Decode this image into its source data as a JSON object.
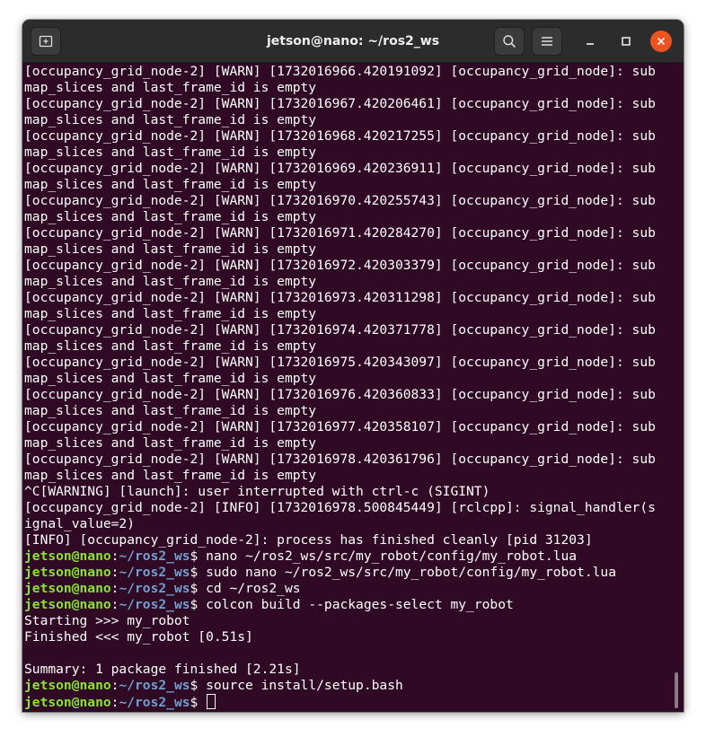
{
  "window": {
    "title": "jetson@nano: ~/ros2_ws",
    "accent": "#e95420",
    "background": "#300a24"
  },
  "toolbar": {
    "new_tab_icon": "new-tab-icon",
    "search_icon": "search-icon",
    "menu_icon": "hamburger-menu-icon",
    "minimize_icon": "minimize-icon",
    "maximize_icon": "maximize-icon",
    "close_icon": "close-icon"
  },
  "terminal": {
    "output_lines": [
      "[occupancy_grid_node-2] [WARN] [1732016966.420191092] [occupancy_grid_node]: sub",
      "map_slices and last_frame_id is empty",
      "[occupancy_grid_node-2] [WARN] [1732016967.420206461] [occupancy_grid_node]: sub",
      "map_slices and last_frame_id is empty",
      "[occupancy_grid_node-2] [WARN] [1732016968.420217255] [occupancy_grid_node]: sub",
      "map_slices and last_frame_id is empty",
      "[occupancy_grid_node-2] [WARN] [1732016969.420236911] [occupancy_grid_node]: sub",
      "map_slices and last_frame_id is empty",
      "[occupancy_grid_node-2] [WARN] [1732016970.420255743] [occupancy_grid_node]: sub",
      "map_slices and last_frame_id is empty",
      "[occupancy_grid_node-2] [WARN] [1732016971.420284270] [occupancy_grid_node]: sub",
      "map_slices and last_frame_id is empty",
      "[occupancy_grid_node-2] [WARN] [1732016972.420303379] [occupancy_grid_node]: sub",
      "map_slices and last_frame_id is empty",
      "[occupancy_grid_node-2] [WARN] [1732016973.420311298] [occupancy_grid_node]: sub",
      "map_slices and last_frame_id is empty",
      "[occupancy_grid_node-2] [WARN] [1732016974.420371778] [occupancy_grid_node]: sub",
      "map_slices and last_frame_id is empty",
      "[occupancy_grid_node-2] [WARN] [1732016975.420343097] [occupancy_grid_node]: sub",
      "map_slices and last_frame_id is empty",
      "[occupancy_grid_node-2] [WARN] [1732016976.420360833] [occupancy_grid_node]: sub",
      "map_slices and last_frame_id is empty",
      "[occupancy_grid_node-2] [WARN] [1732016977.420358107] [occupancy_grid_node]: sub",
      "map_slices and last_frame_id is empty",
      "[occupancy_grid_node-2] [WARN] [1732016978.420361796] [occupancy_grid_node]: sub",
      "map_slices and last_frame_id is empty",
      "^C[WARNING] [launch]: user interrupted with ctrl-c (SIGINT)",
      "[occupancy_grid_node-2] [INFO] [1732016978.500845449] [rclcpp]: signal_handler(s",
      "ignal_value=2)",
      "[INFO] [occupancy_grid_node-2]: process has finished cleanly [pid 31203]"
    ],
    "prompt_user": "jetson@nano",
    "prompt_sep": ":",
    "prompt_path": "~/ros2_ws",
    "prompt_symbol": "$ ",
    "commands": [
      "nano ~/ros2_ws/src/my_robot/config/my_robot.lua",
      "sudo nano ~/ros2_ws/src/my_robot/config/my_robot.lua",
      "cd ~/ros2_ws",
      "colcon build --packages-select my_robot"
    ],
    "build_output": [
      "Starting >>> my_robot",
      "Finished <<< my_robot [0.51s]",
      "",
      "Summary: 1 package finished [2.21s]"
    ],
    "last_command": "source install/setup.bash",
    "current_input": ""
  }
}
